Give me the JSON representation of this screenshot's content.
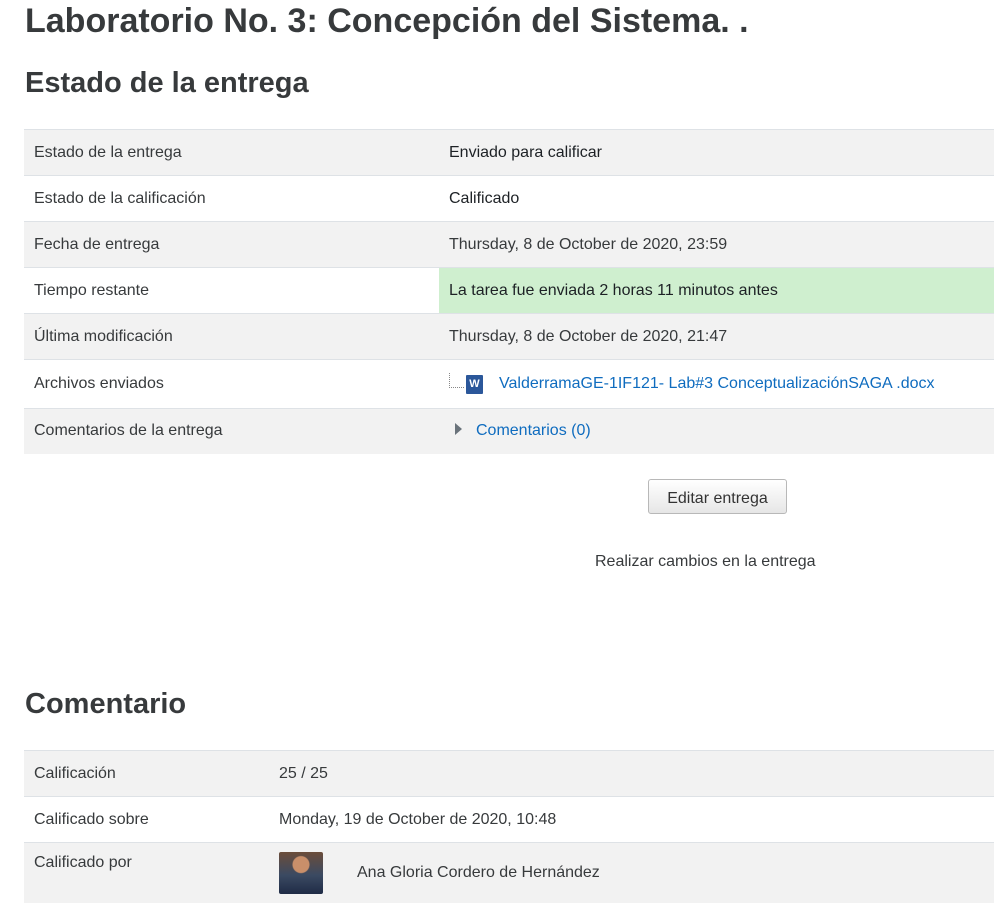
{
  "page_title": "Laboratorio No. 3: Concepción del Sistema. .",
  "submission": {
    "heading": "Estado de la entrega",
    "rows": [
      {
        "label": "Estado de la entrega",
        "value": "Enviado para calificar"
      },
      {
        "label": "Estado de la calificación",
        "value": "Calificado"
      },
      {
        "label": "Fecha de entrega",
        "value": "Thursday, 8 de October de 2020, 23:59"
      },
      {
        "label": "Tiempo restante",
        "value": "La tarea fue enviada 2 horas 11 minutos antes"
      },
      {
        "label": "Última modificación",
        "value": "Thursday, 8 de October de 2020, 21:47"
      },
      {
        "label": "Archivos enviados",
        "value": "ValderramaGE-1IF121- Lab#3 ConceptualizaciónSAGA .docx"
      },
      {
        "label": "Comentarios de la entrega",
        "value": "Comentarios (0)"
      }
    ],
    "file_icon": "word-doc-icon",
    "file_icon_letter": "W",
    "highlight_color": "#cfefcf"
  },
  "edit_button_label": "Editar entrega",
  "edit_hint": "Realizar cambios en la entrega",
  "feedback": {
    "heading": "Comentario",
    "rows": [
      {
        "label": "Calificación",
        "value": "25 / 25"
      },
      {
        "label": "Calificado sobre",
        "value": "Monday, 19 de October de 2020, 10:48"
      },
      {
        "label": "Calificado por",
        "value": "Ana Gloria Cordero de Hernández"
      }
    ]
  },
  "link_color": "#0f6cbf"
}
